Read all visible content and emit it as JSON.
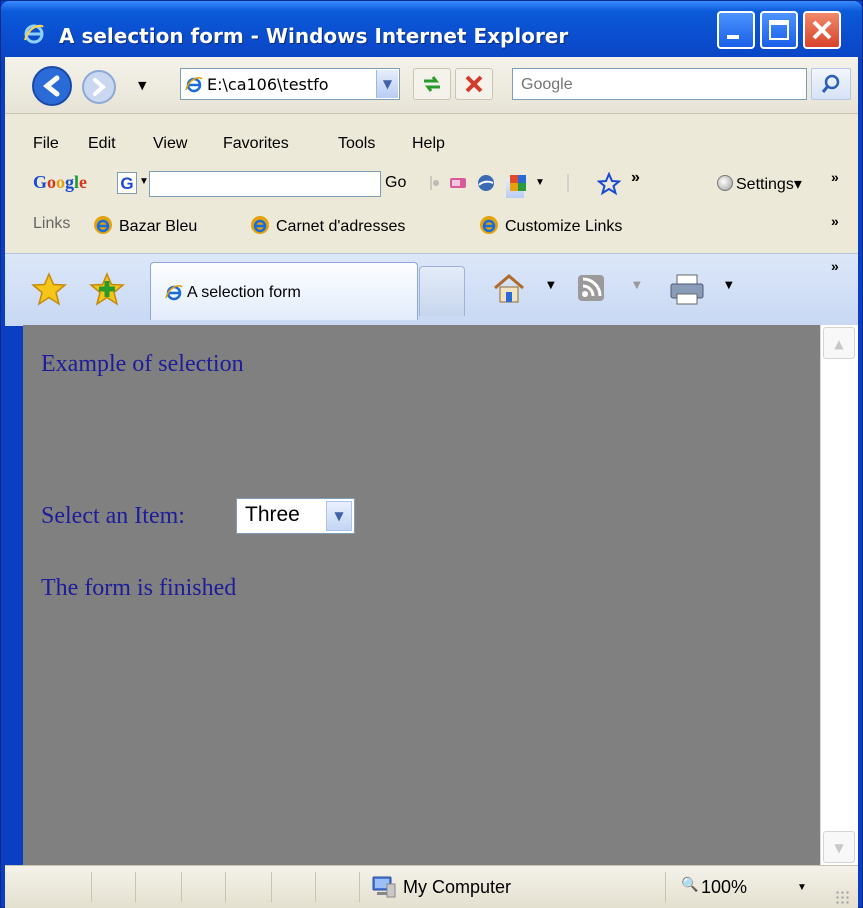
{
  "window": {
    "title": "A selection form - Windows Internet Explorer"
  },
  "nav": {
    "address": "E:\\ca106\\testfo",
    "search_placeholder": "Google"
  },
  "menu": {
    "items": [
      "File",
      "Edit",
      "View",
      "Favorites",
      "Tools",
      "Help"
    ]
  },
  "google_toolbar": {
    "logo": "Google",
    "g_button": "G",
    "go_label": "Go",
    "settings_label": "Settings"
  },
  "links_bar": {
    "label": "Links",
    "items": [
      "Bazar Bleu",
      "Carnet d'adresses",
      "Customize Links"
    ]
  },
  "tabs": {
    "active_title": "A selection form"
  },
  "page": {
    "heading": "Example of selection",
    "select_label": "Select an Item:",
    "select_value": "Three",
    "footer_text": "The form is finished",
    "background_color": "#808080",
    "text_color": "#1d1d99"
  },
  "status": {
    "zone": "My Computer",
    "zoom": "100%"
  },
  "icons": [
    "ie-icon",
    "back-icon",
    "forward-icon",
    "refresh-icon",
    "stop-icon",
    "search-icon",
    "favorites-star-icon",
    "add-favorite-icon",
    "home-icon",
    "rss-icon",
    "print-icon",
    "computer-icon",
    "zoom-icon"
  ]
}
